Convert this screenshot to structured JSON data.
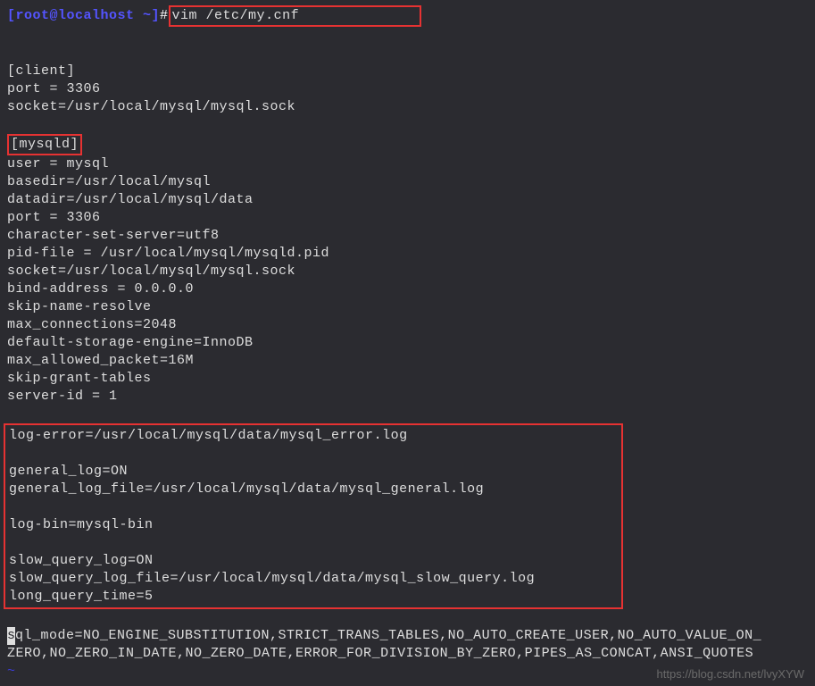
{
  "prompt": {
    "user_host": "[root@localhost ~]",
    "hash": "#",
    "command": "vim /etc/my.cnf"
  },
  "config": {
    "client_section": "[client]",
    "client_port": "port = 3306",
    "client_socket": "socket=/usr/local/mysql/mysql.sock",
    "mysqld_section": "[mysqld]",
    "user": "user = mysql",
    "basedir": "basedir=/usr/local/mysql",
    "datadir": "datadir=/usr/local/mysql/data",
    "mysqld_port": "port = 3306",
    "charset": "character-set-server=utf8",
    "pidfile": "pid-file = /usr/local/mysql/mysqld.pid",
    "mysqld_socket": "socket=/usr/local/mysql/mysql.sock",
    "bind": "bind-address = 0.0.0.0",
    "skip_name": "skip-name-resolve",
    "max_conn": "max_connections=2048",
    "default_engine": "default-storage-engine=InnoDB",
    "max_packet": "max_allowed_packet=16M",
    "skip_grant": "skip-grant-tables",
    "server_id": "server-id = 1",
    "log_error": "log-error=/usr/local/mysql/data/mysql_error.log",
    "general_log": "general_log=ON",
    "general_log_file": "general_log_file=/usr/local/mysql/data/mysql_general.log",
    "log_bin": "log-bin=mysql-bin",
    "slow_query": "slow_query_log=ON",
    "slow_query_file": "slow_query_log_file=/usr/local/mysql/data/mysql_slow_query.log",
    "long_query": "long_query_time=5",
    "sql_mode_first": "s",
    "sql_mode_rest1": "ql_mode=NO_ENGINE_SUBSTITUTION,STRICT_TRANS_TABLES,NO_AUTO_CREATE_USER,NO_AUTO_VALUE_ON_",
    "sql_mode_rest2": "ZERO,NO_ZERO_IN_DATE,NO_ZERO_DATE,ERROR_FOR_DIVISION_BY_ZERO,PIPES_AS_CONCAT,ANSI_QUOTES",
    "tilde": "~"
  },
  "watermark": "https://blog.csdn.net/lvyXYW"
}
